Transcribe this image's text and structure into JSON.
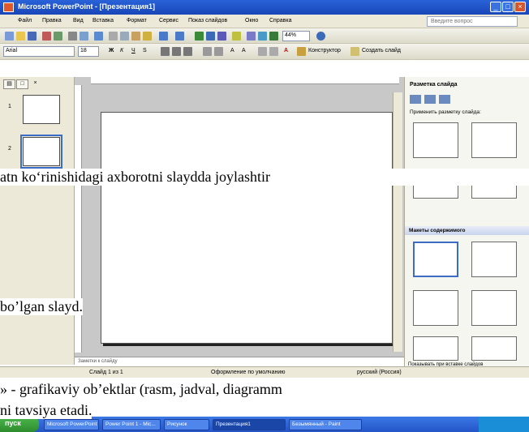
{
  "window": {
    "title": "Microsoft PowerPoint - [Презентация1]"
  },
  "menu": [
    "Файл",
    "Правка",
    "Вид",
    "Вставка",
    "Формат",
    "Сервис",
    "Показ слайдов",
    "Окно",
    "Справка"
  ],
  "help_placeholder": "Введите вопрос",
  "toolbar2": {
    "font": "Arial",
    "size": "18",
    "zoom": "44%"
  },
  "toolbar3": {
    "design_label": "Конструктор",
    "new_slide_label": "Создать слайд"
  },
  "outline": {
    "tab_close": "×",
    "slides": [
      "1",
      "2"
    ]
  },
  "notes_placeholder": "Заметки к слайду",
  "taskpane": {
    "title": "Разметка слайда",
    "apply_label": "Применить разметку слайда:",
    "content_section": "Макеты содержимого",
    "show_on_insert": "Показывать при вставке слайдов"
  },
  "status": {
    "slide": "Слайд 1 из 1",
    "design": "Оформление по умолчанию",
    "lang": "русский (Россия)"
  },
  "taskbar": {
    "start": "пуск",
    "tasks": [
      "Microsoft PowerPoint",
      "Power Point 1 - Mic...",
      "Рисунок",
      "Презентация1",
      "Безымянный - Paint"
    ]
  },
  "doc_text": {
    "line1": "atn  ko‘rinishidagi   axborotni   slaydda  joylashtir",
    "line2": "bo’lgan slayd.",
    "line3": "» - grafikaviy ob’ektlar (rasm, jadval, diagramm",
    "line4": "ni tavsiya etadi."
  }
}
